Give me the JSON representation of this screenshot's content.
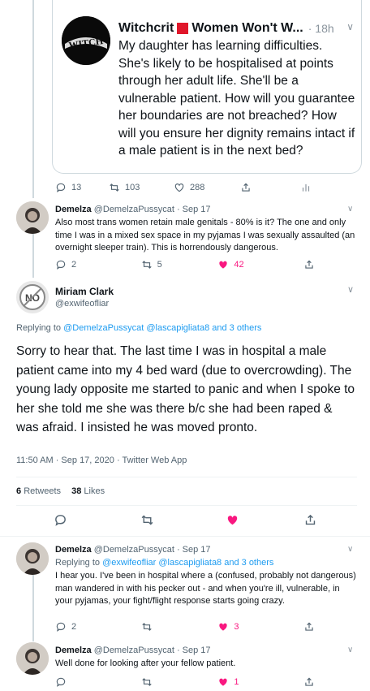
{
  "quoted": {
    "name": "Witchcrit",
    "name_tail": "Women Won't W...",
    "time": "· 18h",
    "text": "My daughter has learning difficulties. She's likely to be hospitalised at points through her adult life. She'll be a vulnerable patient. How will you guarantee her boundaries are not breached? How will you ensure her dignity remains intact if a male patient is in the next bed?",
    "avatar_text": "WITCH",
    "replies": "13",
    "retweets": "103",
    "likes": "288"
  },
  "reply1": {
    "name": "Demelza",
    "handle_time": "@DemelzaPussycat · Sep 17",
    "text": "Also most trans women retain male genitals - 80% is it? The one and only time I was in a mixed sex space in my pyjamas I was sexually assaulted (an overnight sleeper train). This is horrendously dangerous.",
    "replies": "2",
    "retweets": "5",
    "likes": "42"
  },
  "main": {
    "name": "Miriam Clark",
    "handle": "@exwifeofliar",
    "avatar_text": "NO",
    "replying_prefix": "Replying to",
    "replying_to": "@DemelzaPussycat @lascapigliata8 and 3 others",
    "text": "Sorry to hear that.  The last time I was in hospital a male patient came into my 4 bed ward (due to overcrowding).  The young lady opposite me started to panic and when I spoke to her she told me she was there b/c she had been raped & was afraid.  I insisted he was moved pronto.",
    "timestamp": "11:50 AM · Sep 17, 2020 · Twitter Web App",
    "retweets_count": "6",
    "retweets_label": "Retweets",
    "likes_count": "38",
    "likes_label": "Likes"
  },
  "reply2": {
    "name": "Demelza",
    "handle_time": "@DemelzaPussycat · Sep 17",
    "replying_prefix": "Replying to",
    "replying_to": "@exwifeofliar @lascapigliata8 and 3 others",
    "text": "I hear you. I've been in hospital where a (confused, probably not dangerous) man wandered in with his pecker out - and when you're ill, vulnerable, in your pyjamas, your fight/flight response starts going crazy.",
    "replies": "2",
    "likes": "3"
  },
  "reply3": {
    "name": "Demelza",
    "handle_time": "@DemelzaPussycat · Sep 17",
    "text": "Well done for looking after your fellow patient.",
    "likes": "1"
  },
  "colors": {
    "accent": "#1d9bf0",
    "like": "#f91880",
    "muted": "#536471",
    "border": "#cfd9de"
  },
  "icons": [
    "reply-icon",
    "retweet-icon",
    "like-icon",
    "share-icon",
    "analytics-icon",
    "chevron-down-icon"
  ]
}
